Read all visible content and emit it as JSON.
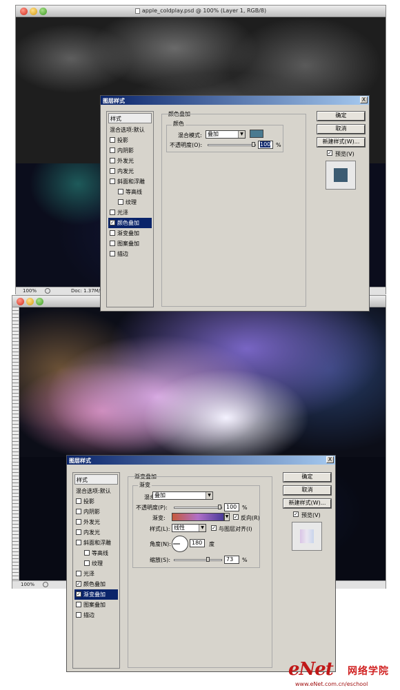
{
  "window1": {
    "title": "apple_coldplay.psd @ 100% (Layer 1, RGB/8)",
    "zoom": "100%",
    "doc_info": "Doc: 1.37M/5!"
  },
  "window2": {
    "zoom": "100%"
  },
  "dialog1": {
    "title": "图层样式",
    "close": "X",
    "styles_header": "样式",
    "items": [
      {
        "label": "混合选项:默认",
        "checkbox": false,
        "checked": false,
        "selected": false,
        "indent": false
      },
      {
        "label": "投影",
        "checkbox": true,
        "checked": false,
        "selected": false,
        "indent": false
      },
      {
        "label": "内阴影",
        "checkbox": true,
        "checked": false,
        "selected": false,
        "indent": false
      },
      {
        "label": "外发光",
        "checkbox": true,
        "checked": false,
        "selected": false,
        "indent": false
      },
      {
        "label": "内发光",
        "checkbox": true,
        "checked": false,
        "selected": false,
        "indent": false
      },
      {
        "label": "斜面和浮雕",
        "checkbox": true,
        "checked": false,
        "selected": false,
        "indent": false
      },
      {
        "label": "等高线",
        "checkbox": true,
        "checked": false,
        "selected": false,
        "indent": true
      },
      {
        "label": "纹理",
        "checkbox": true,
        "checked": false,
        "selected": false,
        "indent": true
      },
      {
        "label": "光泽",
        "checkbox": true,
        "checked": false,
        "selected": false,
        "indent": false
      },
      {
        "label": "颜色叠加",
        "checkbox": true,
        "checked": true,
        "selected": true,
        "indent": false
      },
      {
        "label": "渐变叠加",
        "checkbox": true,
        "checked": false,
        "selected": false,
        "indent": false
      },
      {
        "label": "图案叠加",
        "checkbox": true,
        "checked": false,
        "selected": false,
        "indent": false
      },
      {
        "label": "描边",
        "checkbox": true,
        "checked": false,
        "selected": false,
        "indent": false
      }
    ],
    "section_title": "颜色叠加",
    "group_title": "颜色",
    "blend_label": "混合模式:",
    "blend_value": "叠加",
    "swatch_color": "#4a7a90",
    "opacity_label": "不透明度(O):",
    "opacity_value": "100",
    "opacity_unit": "%",
    "opacity_level": 1.0,
    "buttons": {
      "ok": "确定",
      "cancel": "取消",
      "new_style": "新建样式(W)...",
      "preview": "预览(V)"
    },
    "preview_checked": true,
    "preview_color": "#3c5b72"
  },
  "dialog2": {
    "title": "图层样式",
    "close": "X",
    "styles_header": "样式",
    "items": [
      {
        "label": "混合选项:默认",
        "checkbox": false,
        "checked": false,
        "selected": false,
        "indent": false
      },
      {
        "label": "投影",
        "checkbox": true,
        "checked": false,
        "selected": false,
        "indent": false
      },
      {
        "label": "内阴影",
        "checkbox": true,
        "checked": false,
        "selected": false,
        "indent": false
      },
      {
        "label": "外发光",
        "checkbox": true,
        "checked": false,
        "selected": false,
        "indent": false
      },
      {
        "label": "内发光",
        "checkbox": true,
        "checked": false,
        "selected": false,
        "indent": false
      },
      {
        "label": "斜面和浮雕",
        "checkbox": true,
        "checked": false,
        "selected": false,
        "indent": false
      },
      {
        "label": "等高线",
        "checkbox": true,
        "checked": false,
        "selected": false,
        "indent": true
      },
      {
        "label": "纹理",
        "checkbox": true,
        "checked": false,
        "selected": false,
        "indent": true
      },
      {
        "label": "光泽",
        "checkbox": true,
        "checked": false,
        "selected": false,
        "indent": false
      },
      {
        "label": "颜色叠加",
        "checkbox": true,
        "checked": true,
        "selected": false,
        "indent": false
      },
      {
        "label": "渐变叠加",
        "checkbox": true,
        "checked": true,
        "selected": true,
        "indent": false
      },
      {
        "label": "图案叠加",
        "checkbox": true,
        "checked": false,
        "selected": false,
        "indent": false
      },
      {
        "label": "描边",
        "checkbox": true,
        "checked": false,
        "selected": false,
        "indent": false
      }
    ],
    "section_title": "渐变叠加",
    "group_title": "渐变",
    "blend_label": "混合模式:",
    "blend_value": "叠加",
    "opacity_label": "不透明度(P):",
    "opacity_value": "100",
    "opacity_unit": "%",
    "opacity_level": 1.0,
    "gradient_label": "渐变:",
    "gradient_colors": [
      "#c65a3c",
      "#b070c8",
      "#4a3a9a"
    ],
    "reverse_label": "反向(R)",
    "reverse_checked": true,
    "style_label": "样式(L):",
    "style_value": "线性",
    "align_label": "与图层对齐(I)",
    "align_checked": true,
    "angle_label": "角度(N):",
    "angle_value": "180",
    "angle_unit": "度",
    "scale_label": "缩放(S):",
    "scale_value": "73",
    "scale_unit": "%",
    "scale_level": 0.73,
    "buttons": {
      "ok": "确定",
      "cancel": "取消",
      "new_style": "新建样式(W)...",
      "preview": "预览(V)"
    },
    "preview_checked": true
  },
  "watermark": {
    "brand": "eNet",
    "brand_cn": "网络学院",
    "url": "www.eNet.com.cn/eschool"
  }
}
